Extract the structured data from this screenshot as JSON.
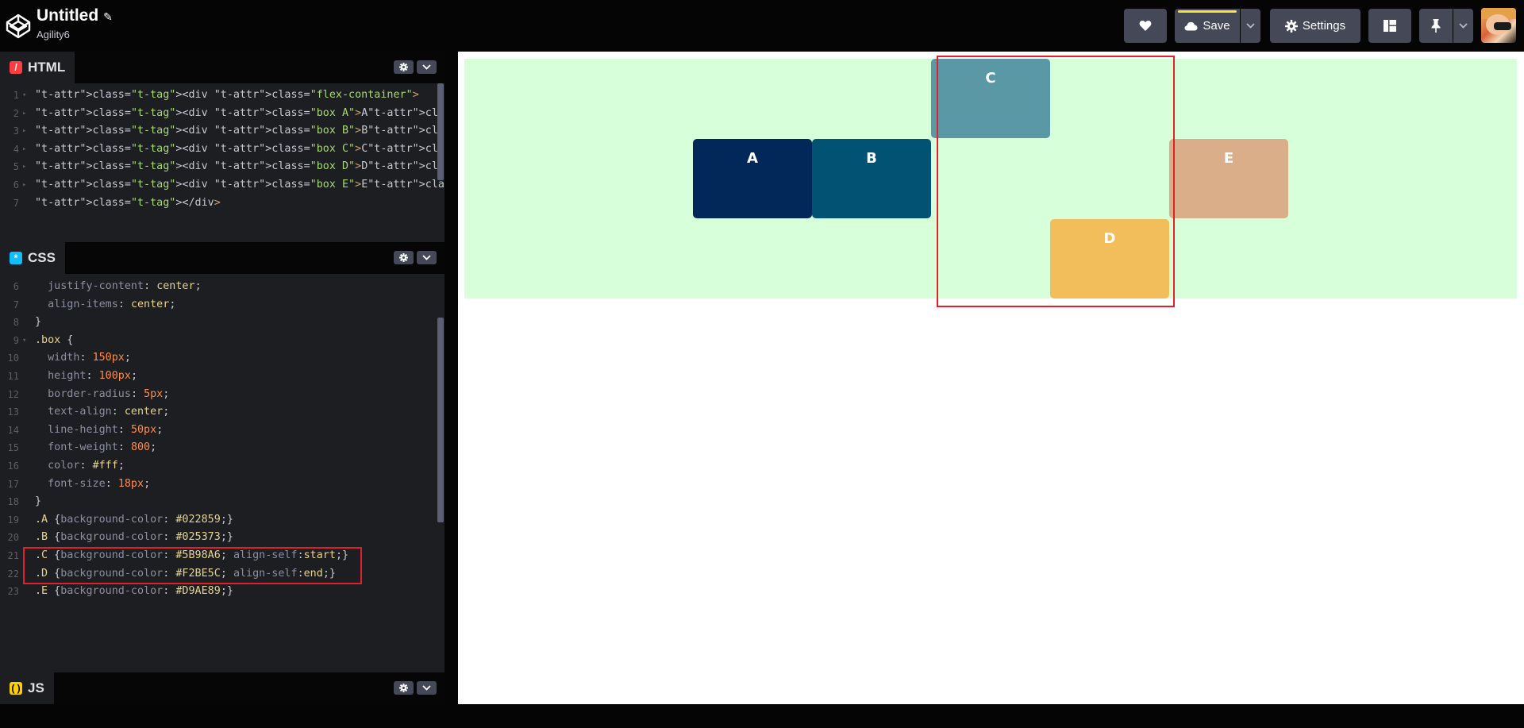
{
  "header": {
    "title": "Untitled",
    "subtitle": "Agility6",
    "save_label": "Save",
    "settings_label": "Settings"
  },
  "html_pane": {
    "label": "HTML",
    "lines": [
      {
        "n": "1",
        "text": "<div class=\"flex-container\">"
      },
      {
        "n": "2",
        "text": "<div class=\"box A\">A</div>"
      },
      {
        "n": "3",
        "text": "<div class=\"box B\">B</div>"
      },
      {
        "n": "4",
        "text": "<div class=\"box C\">C</div>"
      },
      {
        "n": "5",
        "text": "<div class=\"box D\">D</div>"
      },
      {
        "n": "6",
        "text": "<div class=\"box E\">E</div>"
      },
      {
        "n": "7",
        "text": "</div>"
      }
    ]
  },
  "css_pane": {
    "label": "CSS",
    "lines": [
      {
        "n": "6",
        "text": "  justify-content: center;"
      },
      {
        "n": "7",
        "text": "  align-items: center;"
      },
      {
        "n": "8",
        "text": "}"
      },
      {
        "n": "9",
        "text": ".box {"
      },
      {
        "n": "10",
        "text": "  width: 150px;"
      },
      {
        "n": "11",
        "text": "  height: 100px;"
      },
      {
        "n": "12",
        "text": "  border-radius: 5px;"
      },
      {
        "n": "13",
        "text": "  text-align: center;"
      },
      {
        "n": "14",
        "text": "  line-height: 50px;"
      },
      {
        "n": "15",
        "text": "  font-weight: 800;"
      },
      {
        "n": "16",
        "text": "  color: #fff;"
      },
      {
        "n": "17",
        "text": "  font-size: 18px;"
      },
      {
        "n": "18",
        "text": "}"
      },
      {
        "n": "19",
        "text": ".A {background-color: #022859;}"
      },
      {
        "n": "20",
        "text": ".B {background-color: #025373;}"
      },
      {
        "n": "21",
        "text": ".C {background-color: #5B98A6; align-self:start;}"
      },
      {
        "n": "22",
        "text": ".D {background-color: #F2BE5C; align-self:end;}"
      },
      {
        "n": "23",
        "text": ".E {background-color: #D9AE89;}"
      }
    ]
  },
  "js_pane": {
    "label": "JS"
  },
  "preview": {
    "container_color": "#d7ffd9",
    "boxes": [
      {
        "label": "A",
        "color": "#022859"
      },
      {
        "label": "B",
        "color": "#025373"
      },
      {
        "label": "C",
        "color": "#5B98A6"
      },
      {
        "label": "D",
        "color": "#F2BE5C"
      },
      {
        "label": "E",
        "color": "#D9AE89"
      }
    ]
  },
  "icons": {
    "logo": "codepen-logo-icon",
    "edit": "pencil-icon",
    "heart": "heart-icon",
    "save": "cloud-icon",
    "settings": "gear-icon",
    "layout": "layout-icon",
    "pin": "pin-icon",
    "caret": "chevron-down-icon"
  },
  "highlight_color": "#e0202a"
}
